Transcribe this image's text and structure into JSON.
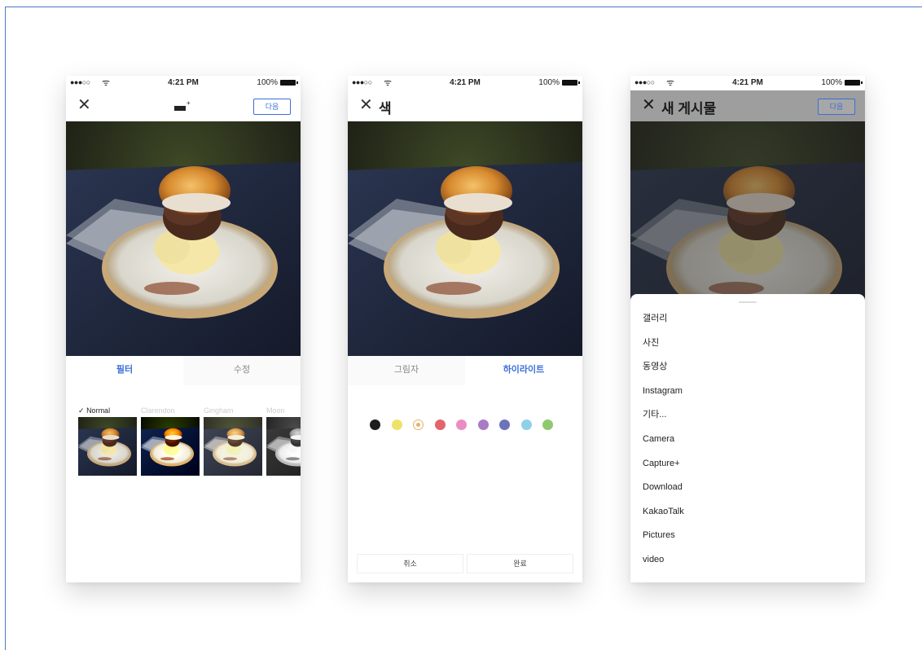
{
  "status": {
    "time": "4:21 PM",
    "battery": "100%",
    "signal": "●●●○○",
    "wifi": "ᯤ"
  },
  "icons": {
    "close": "✕",
    "check": "✓",
    "brush_spark": "+"
  },
  "screen1": {
    "next_label": "다음",
    "tabs": [
      "필터",
      "수정"
    ],
    "filters": [
      {
        "label": "Normal",
        "selected": true
      },
      {
        "label": "Clarendon",
        "selected": false
      },
      {
        "label": "Gingham",
        "selected": false
      },
      {
        "label": "Moon",
        "selected": false
      }
    ]
  },
  "screen2": {
    "title": "색",
    "tabs": [
      "그림자",
      "하이라이트"
    ],
    "swatches": [
      "#1e1e1e",
      "#ede26a",
      "#e3b36a",
      "#e3646c",
      "#eb8dc3",
      "#a97bc6",
      "#6d73b9",
      "#8fd1e8",
      "#8fc96e"
    ],
    "selected_swatch": 2,
    "cancel_label": "취소",
    "done_label": "완료"
  },
  "screen3": {
    "title": "새 게시물",
    "next_label": "다음",
    "albums": [
      "갤러리",
      "사진",
      "동영상",
      "Instagram",
      "기타...",
      "Camera",
      "Capture+",
      "Download",
      "KakaoTalk",
      "Pictures",
      "video"
    ]
  }
}
